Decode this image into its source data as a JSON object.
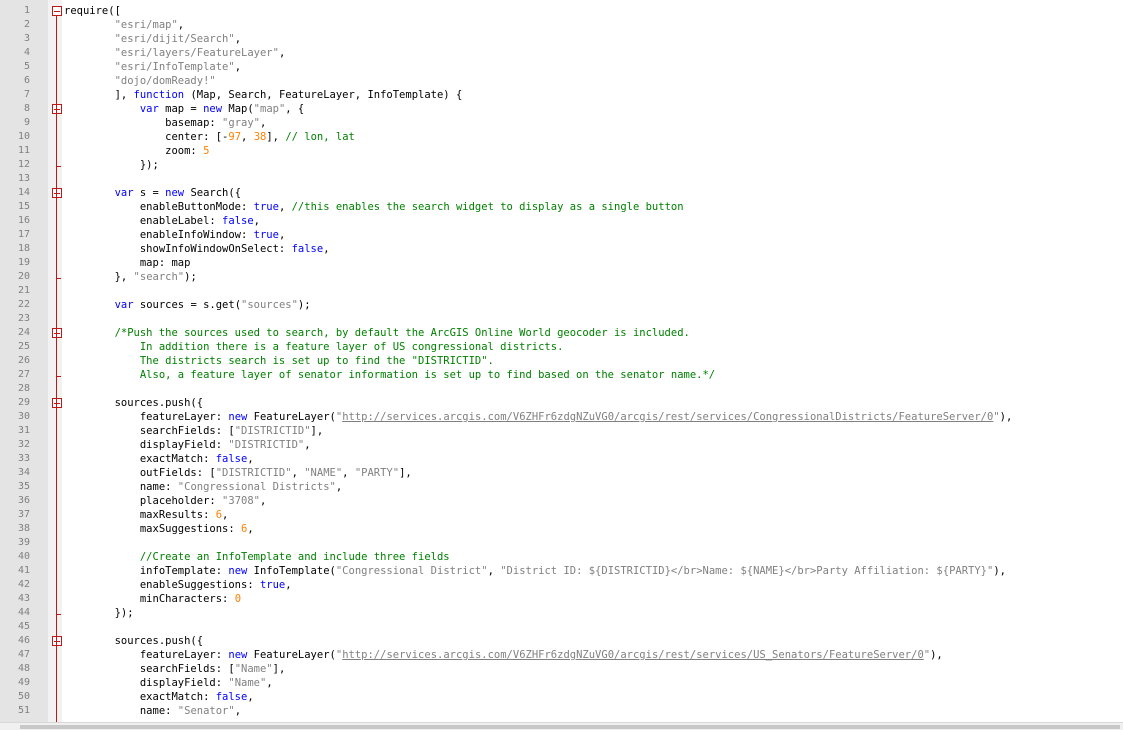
{
  "editor": {
    "lines": [
      {
        "n": "1",
        "fold": "open",
        "tokens": [
          [
            "p",
            "require(["
          ]
        ]
      },
      {
        "n": "2",
        "tokens": [
          [
            "p",
            "        "
          ],
          [
            "s",
            "\"esri/map\""
          ],
          [
            "p",
            ","
          ]
        ]
      },
      {
        "n": "3",
        "tokens": [
          [
            "p",
            "        "
          ],
          [
            "s",
            "\"esri/dijit/Search\""
          ],
          [
            "p",
            ","
          ]
        ]
      },
      {
        "n": "4",
        "tokens": [
          [
            "p",
            "        "
          ],
          [
            "s",
            "\"esri/layers/FeatureLayer\""
          ],
          [
            "p",
            ","
          ]
        ]
      },
      {
        "n": "5",
        "tokens": [
          [
            "p",
            "        "
          ],
          [
            "s",
            "\"esri/InfoTemplate\""
          ],
          [
            "p",
            ","
          ]
        ]
      },
      {
        "n": "6",
        "tokens": [
          [
            "p",
            "        "
          ],
          [
            "s",
            "\"dojo/domReady!\""
          ]
        ]
      },
      {
        "n": "7",
        "tokens": [
          [
            "p",
            "        ], "
          ],
          [
            "k",
            "function"
          ],
          [
            "p",
            " (Map, Search, FeatureLayer, InfoTemplate) {"
          ]
        ]
      },
      {
        "n": "8",
        "fold": "open",
        "tokens": [
          [
            "p",
            "            "
          ],
          [
            "k",
            "var"
          ],
          [
            "p",
            " map = "
          ],
          [
            "k",
            "new"
          ],
          [
            "p",
            " Map("
          ],
          [
            "s",
            "\"map\""
          ],
          [
            "p",
            ", {"
          ]
        ]
      },
      {
        "n": "9",
        "tokens": [
          [
            "p",
            "                basemap: "
          ],
          [
            "s",
            "\"gray\""
          ],
          [
            "p",
            ","
          ]
        ]
      },
      {
        "n": "10",
        "tokens": [
          [
            "p",
            "                center: [-"
          ],
          [
            "n",
            "97"
          ],
          [
            "p",
            ", "
          ],
          [
            "n",
            "38"
          ],
          [
            "p",
            "], "
          ],
          [
            "c",
            "// lon, lat"
          ]
        ]
      },
      {
        "n": "11",
        "tokens": [
          [
            "p",
            "                zoom: "
          ],
          [
            "n",
            "5"
          ]
        ]
      },
      {
        "n": "12",
        "fold": "end",
        "tokens": [
          [
            "p",
            "            });"
          ]
        ]
      },
      {
        "n": "13",
        "tokens": []
      },
      {
        "n": "14",
        "fold": "open",
        "tokens": [
          [
            "p",
            "        "
          ],
          [
            "k",
            "var"
          ],
          [
            "p",
            " s = "
          ],
          [
            "k",
            "new"
          ],
          [
            "p",
            " Search({"
          ]
        ]
      },
      {
        "n": "15",
        "tokens": [
          [
            "p",
            "            enableButtonMode: "
          ],
          [
            "k",
            "true"
          ],
          [
            "p",
            ", "
          ],
          [
            "c",
            "//this enables the search widget to display as a single button"
          ]
        ]
      },
      {
        "n": "16",
        "tokens": [
          [
            "p",
            "            enableLabel: "
          ],
          [
            "k",
            "false"
          ],
          [
            "p",
            ","
          ]
        ]
      },
      {
        "n": "17",
        "tokens": [
          [
            "p",
            "            enableInfoWindow: "
          ],
          [
            "k",
            "true"
          ],
          [
            "p",
            ","
          ]
        ]
      },
      {
        "n": "18",
        "tokens": [
          [
            "p",
            "            showInfoWindowOnSelect: "
          ],
          [
            "k",
            "false"
          ],
          [
            "p",
            ","
          ]
        ]
      },
      {
        "n": "19",
        "tokens": [
          [
            "p",
            "            map: map"
          ]
        ]
      },
      {
        "n": "20",
        "fold": "end",
        "tokens": [
          [
            "p",
            "        }, "
          ],
          [
            "s",
            "\"search\""
          ],
          [
            "p",
            ");"
          ]
        ]
      },
      {
        "n": "21",
        "tokens": []
      },
      {
        "n": "22",
        "tokens": [
          [
            "p",
            "        "
          ],
          [
            "k",
            "var"
          ],
          [
            "p",
            " sources = s.get("
          ],
          [
            "s",
            "\"sources\""
          ],
          [
            "p",
            ");"
          ]
        ]
      },
      {
        "n": "23",
        "tokens": []
      },
      {
        "n": "24",
        "fold": "open",
        "tokens": [
          [
            "p",
            "        "
          ],
          [
            "c",
            "/*Push the sources used to search, by default the ArcGIS Online World geocoder is included."
          ]
        ]
      },
      {
        "n": "25",
        "tokens": [
          [
            "c",
            "            In addition there is a feature layer of US congressional districts."
          ]
        ]
      },
      {
        "n": "26",
        "tokens": [
          [
            "c",
            "            The districts search is set up to find the \"DISTRICTID\"."
          ]
        ]
      },
      {
        "n": "27",
        "fold": "end",
        "tokens": [
          [
            "c",
            "            Also, a feature layer of senator information is set up to find based on the senator name.*/"
          ]
        ]
      },
      {
        "n": "28",
        "tokens": []
      },
      {
        "n": "29",
        "fold": "open",
        "tokens": [
          [
            "p",
            "        sources.push({"
          ]
        ]
      },
      {
        "n": "30",
        "tokens": [
          [
            "p",
            "            featureLayer: "
          ],
          [
            "k",
            "new"
          ],
          [
            "p",
            " FeatureLayer("
          ],
          [
            "s",
            "\""
          ],
          [
            "u",
            "http://services.arcgis.com/V6ZHFr6zdgNZuVG0/arcgis/rest/services/CongressionalDistricts/FeatureServer/0"
          ],
          [
            "s",
            "\""
          ],
          [
            "p",
            "),"
          ]
        ]
      },
      {
        "n": "31",
        "tokens": [
          [
            "p",
            "            searchFields: ["
          ],
          [
            "s",
            "\"DISTRICTID\""
          ],
          [
            "p",
            "],"
          ]
        ]
      },
      {
        "n": "32",
        "tokens": [
          [
            "p",
            "            displayField: "
          ],
          [
            "s",
            "\"DISTRICTID\""
          ],
          [
            "p",
            ","
          ]
        ]
      },
      {
        "n": "33",
        "tokens": [
          [
            "p",
            "            exactMatch: "
          ],
          [
            "k",
            "false"
          ],
          [
            "p",
            ","
          ]
        ]
      },
      {
        "n": "34",
        "tokens": [
          [
            "p",
            "            outFields: ["
          ],
          [
            "s",
            "\"DISTRICTID\""
          ],
          [
            "p",
            ", "
          ],
          [
            "s",
            "\"NAME\""
          ],
          [
            "p",
            ", "
          ],
          [
            "s",
            "\"PARTY\""
          ],
          [
            "p",
            "],"
          ]
        ]
      },
      {
        "n": "35",
        "tokens": [
          [
            "p",
            "            name: "
          ],
          [
            "s",
            "\"Congressional Districts\""
          ],
          [
            "p",
            ","
          ]
        ]
      },
      {
        "n": "36",
        "tokens": [
          [
            "p",
            "            placeholder: "
          ],
          [
            "s",
            "\"3708\""
          ],
          [
            "p",
            ","
          ]
        ]
      },
      {
        "n": "37",
        "tokens": [
          [
            "p",
            "            maxResults: "
          ],
          [
            "n",
            "6"
          ],
          [
            "p",
            ","
          ]
        ]
      },
      {
        "n": "38",
        "tokens": [
          [
            "p",
            "            maxSuggestions: "
          ],
          [
            "n",
            "6"
          ],
          [
            "p",
            ","
          ]
        ]
      },
      {
        "n": "39",
        "tokens": []
      },
      {
        "n": "40",
        "tokens": [
          [
            "p",
            "            "
          ],
          [
            "c",
            "//Create an InfoTemplate and include three fields"
          ]
        ]
      },
      {
        "n": "41",
        "tokens": [
          [
            "p",
            "            infoTemplate: "
          ],
          [
            "k",
            "new"
          ],
          [
            "p",
            " InfoTemplate("
          ],
          [
            "s",
            "\"Congressional District\""
          ],
          [
            "p",
            ", "
          ],
          [
            "s",
            "\"District ID: ${DISTRICTID}</br>Name: ${NAME}</br>Party Affiliation: ${PARTY}\""
          ],
          [
            "p",
            "),"
          ]
        ]
      },
      {
        "n": "42",
        "tokens": [
          [
            "p",
            "            enableSuggestions: "
          ],
          [
            "k",
            "true"
          ],
          [
            "p",
            ","
          ]
        ]
      },
      {
        "n": "43",
        "tokens": [
          [
            "p",
            "            minCharacters: "
          ],
          [
            "n",
            "0"
          ]
        ]
      },
      {
        "n": "44",
        "fold": "end",
        "tokens": [
          [
            "p",
            "        });"
          ]
        ]
      },
      {
        "n": "45",
        "tokens": []
      },
      {
        "n": "46",
        "fold": "open",
        "tokens": [
          [
            "p",
            "        sources.push({"
          ]
        ]
      },
      {
        "n": "47",
        "tokens": [
          [
            "p",
            "            featureLayer: "
          ],
          [
            "k",
            "new"
          ],
          [
            "p",
            " FeatureLayer("
          ],
          [
            "s",
            "\""
          ],
          [
            "u",
            "http://services.arcgis.com/V6ZHFr6zdgNZuVG0/arcgis/rest/services/US_Senators/FeatureServer/0"
          ],
          [
            "s",
            "\""
          ],
          [
            "p",
            "),"
          ]
        ]
      },
      {
        "n": "48",
        "tokens": [
          [
            "p",
            "            searchFields: ["
          ],
          [
            "s",
            "\"Name\""
          ],
          [
            "p",
            "],"
          ]
        ]
      },
      {
        "n": "49",
        "tokens": [
          [
            "p",
            "            displayField: "
          ],
          [
            "s",
            "\"Name\""
          ],
          [
            "p",
            ","
          ]
        ]
      },
      {
        "n": "50",
        "tokens": [
          [
            "p",
            "            exactMatch: "
          ],
          [
            "k",
            "false"
          ],
          [
            "p",
            ","
          ]
        ]
      },
      {
        "n": "51",
        "tokens": [
          [
            "p",
            "            name: "
          ],
          [
            "s",
            "\"Senator\""
          ],
          [
            "p",
            ","
          ]
        ]
      }
    ]
  }
}
